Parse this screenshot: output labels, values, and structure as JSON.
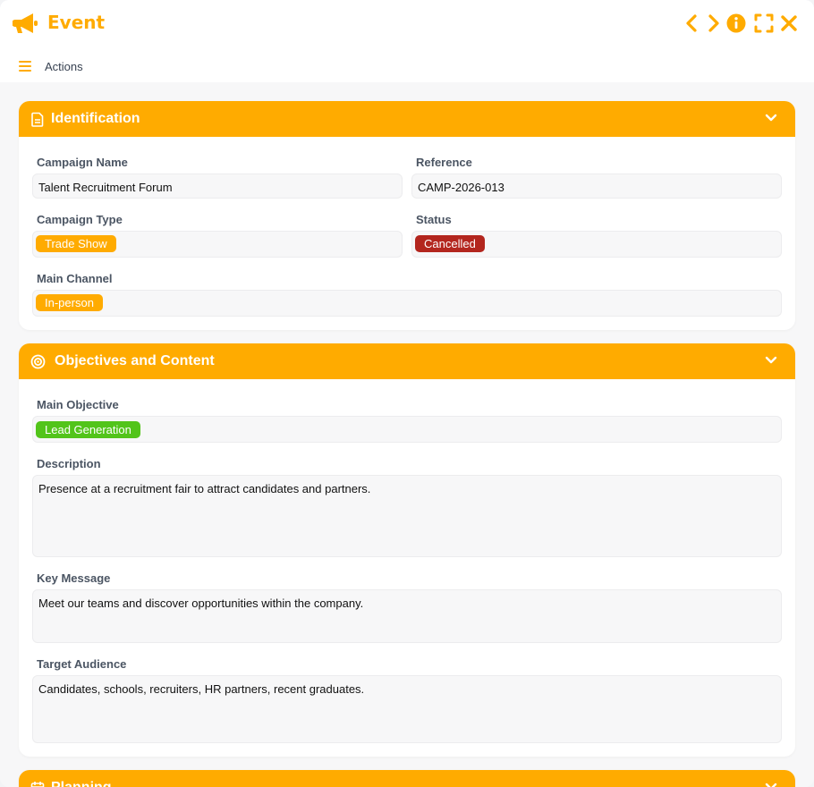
{
  "window": {
    "title": "Event",
    "actions_label": "Actions"
  },
  "colors": {
    "accent": "#ffab00",
    "status_cancelled": "#b3261e",
    "objective_green": "#52c41a"
  },
  "icons": {
    "title": "megaphone-icon",
    "prev": "chevron-left-icon",
    "next": "chevron-right-icon",
    "info": "info-icon",
    "fullscreen": "expand-icon",
    "close": "close-icon",
    "menu": "menu-icon"
  },
  "identification": {
    "title": "Identification",
    "campaign_name_label": "Campaign Name",
    "campaign_name": "Talent Recruitment Forum",
    "reference_label": "Reference",
    "reference": "CAMP-2026-013",
    "campaign_type_label": "Campaign Type",
    "campaign_type": "Trade Show",
    "status_label": "Status",
    "status": "Cancelled",
    "main_channel_label": "Main Channel",
    "main_channel": "In-person"
  },
  "objectives": {
    "title": "Objectives and Content",
    "main_objective_label": "Main Objective",
    "main_objective": "Lead Generation",
    "description_label": "Description",
    "description": "Presence at a recruitment fair to attract candidates and partners.",
    "key_message_label": "Key Message",
    "key_message": "Meet our teams and discover opportunities within the company.",
    "target_audience_label": "Target Audience",
    "target_audience": "Candidates, schools, recruiters, HR partners, recent graduates."
  },
  "planning": {
    "title": "Planning"
  }
}
